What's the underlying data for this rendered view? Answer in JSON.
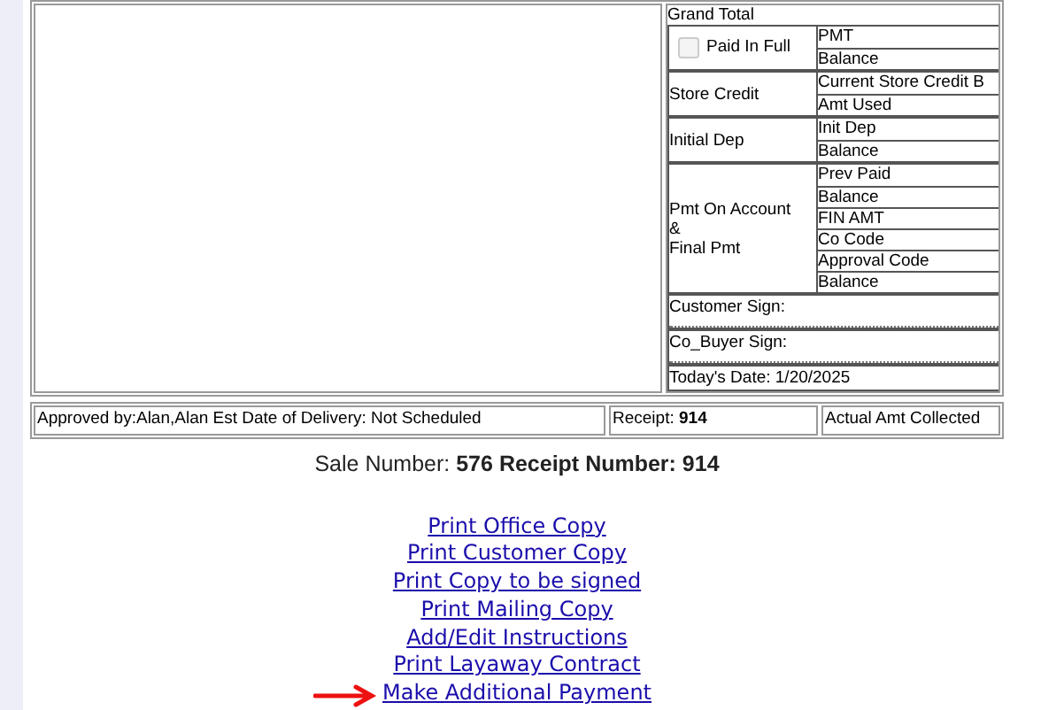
{
  "grand_total_label": "Grand Total",
  "payment_rows": [
    {
      "label": "Paid In Full",
      "kind": "checkbox",
      "checked": false,
      "disabled": true,
      "fields": [
        "PMT",
        "Balance"
      ]
    },
    {
      "label": "Store Credit",
      "kind": "text",
      "fields": [
        "Current Store Credit B",
        "Amt Used"
      ]
    },
    {
      "label": "Initial Dep",
      "kind": "text",
      "fields": [
        "Init Dep",
        "Balance"
      ]
    },
    {
      "label": "Pmt On Account\n&\nFinal Pmt",
      "kind": "text",
      "fields": [
        "Prev Paid",
        "Balance",
        "FIN AMT",
        "Co Code",
        "Approval Code",
        "Balance"
      ]
    }
  ],
  "signatures": [
    "Customer Sign:",
    "Co_Buyer Sign:"
  ],
  "todays_date": "Today's Date: 1/20/2025",
  "footer_row": {
    "approved": "Approved by:Alan,Alan Est Date of Delivery: Not Scheduled",
    "receipt_label": "Receipt:",
    "receipt_value": "914",
    "collected": "Actual Amt Collected"
  },
  "sale_line": "Sale Number: **576 Receipt Number: 914**",
  "links": [
    {
      "label": "Print Office Copy",
      "highlighted": false
    },
    {
      "label": "Print Customer Copy",
      "highlighted": false
    },
    {
      "label": "Print Copy to be signed",
      "highlighted": false
    },
    {
      "label": "Print Mailing Copy",
      "highlighted": false
    },
    {
      "label": "Add/Edit Instructions",
      "highlighted": false
    },
    {
      "label": "Print Layaway Contract",
      "highlighted": false
    },
    {
      "label": "Make Additional Payment",
      "highlighted": true
    }
  ]
}
